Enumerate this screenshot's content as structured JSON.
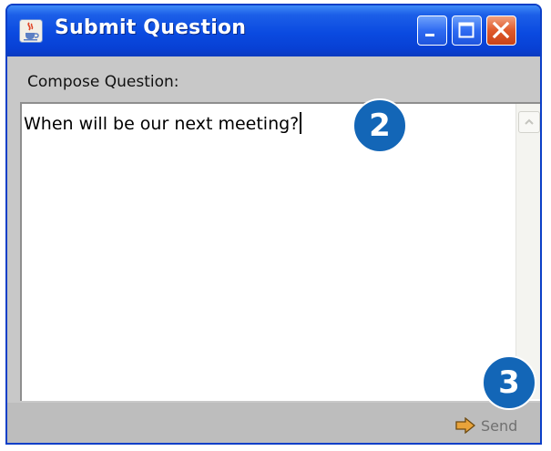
{
  "window": {
    "title": "Submit Question",
    "app_icon": "java-cup-icon",
    "controls": [
      "minimize-icon",
      "maximize-icon",
      "close-icon"
    ]
  },
  "compose": {
    "label": "Compose Question:",
    "value": "When will be our next meeting?"
  },
  "footer": {
    "send_label": "Send",
    "send_icon": "arrow-right-icon"
  },
  "callouts": {
    "step_a": "2",
    "step_b": "3"
  },
  "colors": {
    "titlebar": "#0a4ae0",
    "callout": "#1366b7",
    "close_button": "#df5a2c"
  }
}
